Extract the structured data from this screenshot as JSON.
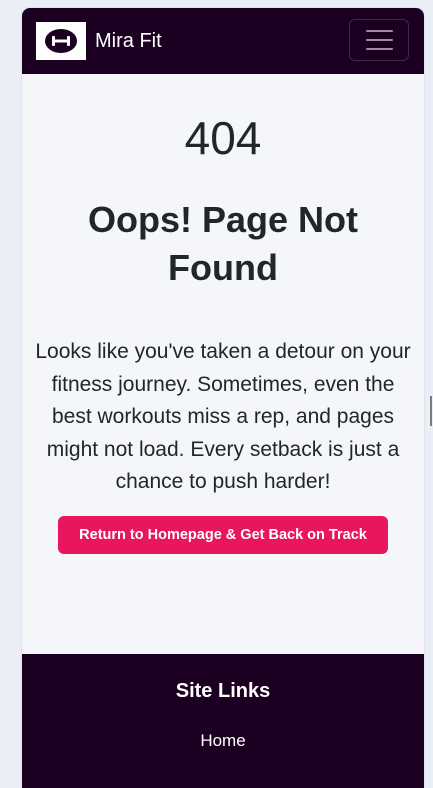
{
  "navbar": {
    "brand": "Mira Fit",
    "logo_icon": "dumbbell-icon",
    "menu_icon": "hamburger-icon"
  },
  "error": {
    "code": "404",
    "title": "Oops! Page Not Found",
    "message": "Looks like you've taken a detour on your fitness journey. Sometimes, even the best workouts miss a rep, and pages might not load. Every setback is just a chance to push harder!",
    "cta_label": "Return to Homepage & Get Back on Track"
  },
  "footer": {
    "title": "Site Links",
    "links": [
      "Home"
    ]
  },
  "colors": {
    "nav_bg": "#1b0022",
    "accent": "#e8175d",
    "page_bg": "#f4f6fa"
  }
}
